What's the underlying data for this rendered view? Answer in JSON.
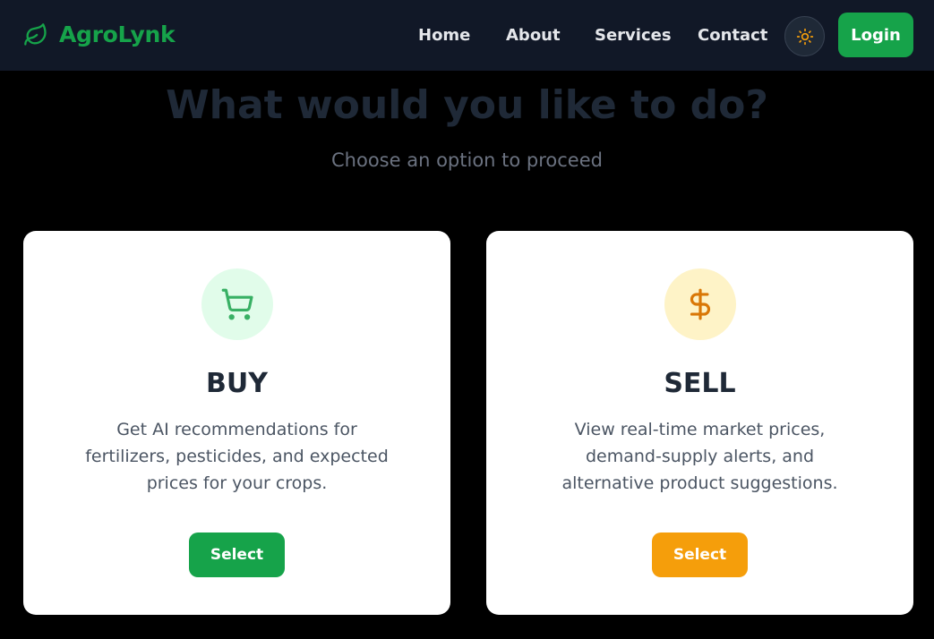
{
  "brand": {
    "name": "AgroLynk",
    "icon": "leaf-icon",
    "color": "#16a34a"
  },
  "nav": {
    "links": [
      "Home",
      "About",
      "Services",
      "Contact"
    ],
    "theme_toggle_icon": "sun-icon",
    "login_label": "Login"
  },
  "hero": {
    "title": "What would you like to do?",
    "subtitle": "Choose an option to proceed"
  },
  "options": [
    {
      "title": "BUY",
      "description": "Get AI recommendations for fertilizers, pesticides, and expected prices for your crops.",
      "button_label": "Select",
      "icon": "shopping-cart-icon",
      "accent": "#16a34a"
    },
    {
      "title": "SELL",
      "description": "View real-time market prices, demand-supply alerts, and alternative product suggestions.",
      "button_label": "Select",
      "icon": "dollar-sign-icon",
      "accent": "#f59e0b"
    }
  ]
}
